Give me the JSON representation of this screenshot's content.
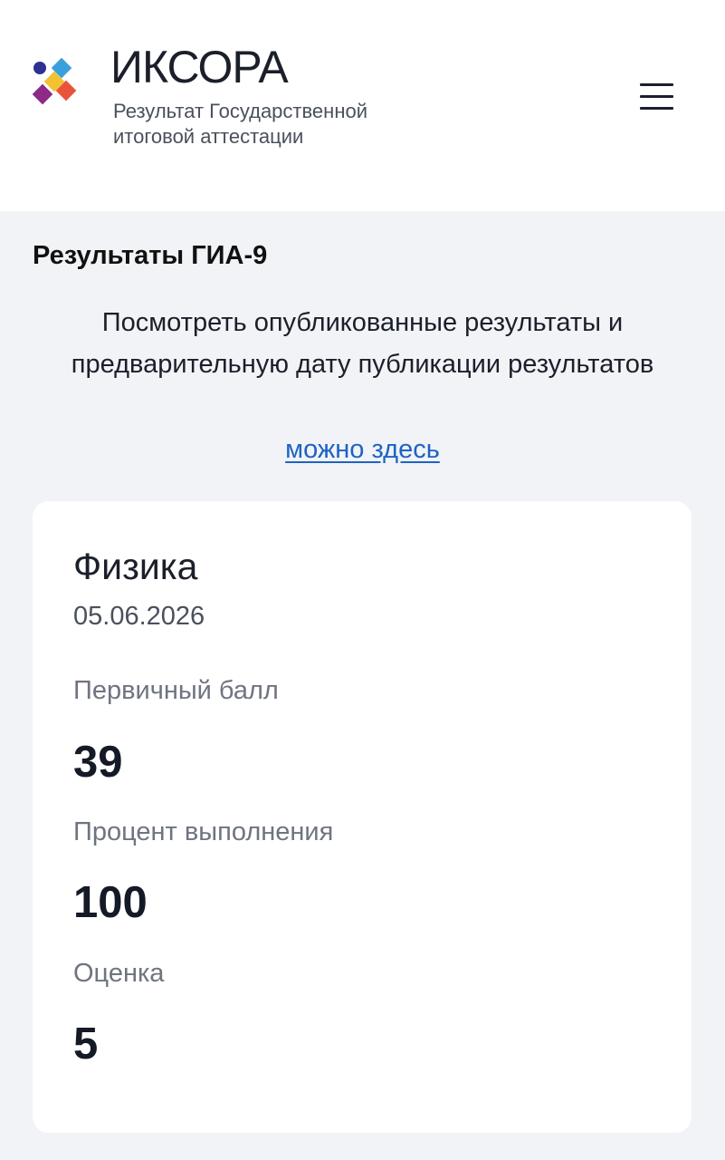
{
  "header": {
    "brand_name": "ИКСОРА",
    "brand_subtitle_line1": "Результат Государственной",
    "brand_subtitle_line2": "итоговой аттестации",
    "logo_colors": [
      "#2e3192",
      "#3aa0dc",
      "#f2c230",
      "#8b2a87",
      "#e8533a"
    ],
    "menu_icon": "hamburger-menu-icon"
  },
  "main": {
    "section_title": "Результаты ГИА-9",
    "intro_text": "Посмотреть опубликованные результаты и предварительную дату публикации результатов",
    "intro_link": "можно здесь",
    "link_color": "#1e63c4"
  },
  "result_card": {
    "subject": "Физика",
    "date": "05.06.2026",
    "fields": [
      {
        "label": "Первичный балл",
        "value": "39"
      },
      {
        "label": "Процент выполнения",
        "value": "100"
      },
      {
        "label": "Оценка",
        "value": "5"
      }
    ]
  }
}
